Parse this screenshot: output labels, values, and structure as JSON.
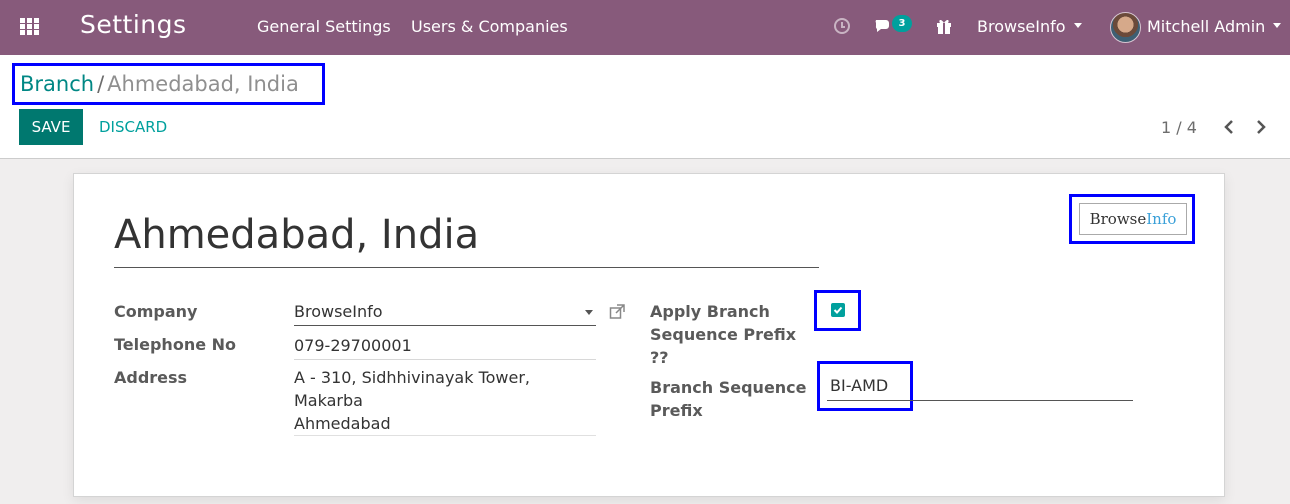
{
  "navbar": {
    "app_title": "Settings",
    "menu": [
      "General Settings",
      "Users & Companies"
    ],
    "chat_badge": "3",
    "company": "BrowseInfo",
    "user": "Mitchell Admin",
    "icons": [
      "apps-grid-icon",
      "clock-icon",
      "chat-icon",
      "gift-icon"
    ]
  },
  "breadcrumb": {
    "parent": "Branch",
    "separator": "/",
    "current": "Ahmedabad, India"
  },
  "actions": {
    "save": "SAVE",
    "discard": "DISCARD"
  },
  "pager": {
    "text": "1 / 4"
  },
  "form": {
    "title": "Ahmedabad, India",
    "logo": {
      "part1": "Browse",
      "part2": "Info"
    },
    "company_label": "Company",
    "company_value": "BrowseInfo",
    "telephone_label": "Telephone No",
    "telephone_value": "079-29700001",
    "address_label": "Address",
    "address_lines": [
      "A - 310, Sidhhivinayak Tower,",
      "Makarba",
      "Ahmedabad"
    ],
    "apply_prefix_label": [
      "Apply Branch",
      "Sequence Prefix",
      "??"
    ],
    "apply_prefix_checked": true,
    "seq_prefix_label": [
      "Branch Sequence",
      "Prefix"
    ],
    "seq_prefix_value": "BI-AMD"
  },
  "colors": {
    "navbar": "#875a7b",
    "primary": "#00786f",
    "accent": "#00a09d",
    "highlight": "#0000ff"
  }
}
